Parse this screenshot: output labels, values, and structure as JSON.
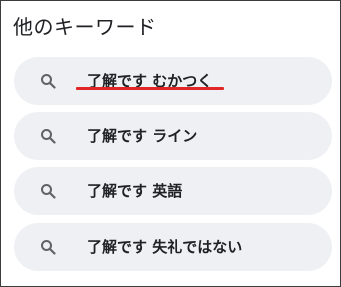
{
  "panel": {
    "title": "他のキーワード",
    "highlight_color": "#e02626"
  },
  "suggestions": [
    {
      "label": "了解です むかつく",
      "icon": "search-icon"
    },
    {
      "label": "了解です ライン",
      "icon": "search-icon"
    },
    {
      "label": "了解です 英語",
      "icon": "search-icon"
    },
    {
      "label": "了解です 失礼ではない",
      "icon": "search-icon"
    }
  ]
}
